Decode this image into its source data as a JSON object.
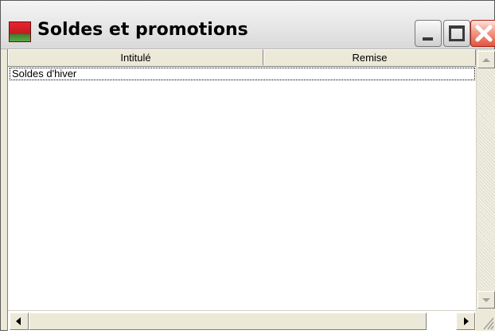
{
  "window": {
    "title": "Soldes et promotions",
    "icon": "app-flag-icon",
    "controls": [
      "minimize-icon",
      "maximize-icon",
      "close-icon"
    ]
  },
  "table": {
    "columns": [
      {
        "label": "Intitulé"
      },
      {
        "label": "Remise"
      }
    ],
    "rows": [
      {
        "intitule": "Soldes d'hiver",
        "remise": ""
      }
    ]
  },
  "colors": {
    "titlebar": "#e6e6e6",
    "close_button": "#e2553d",
    "icon_red": "#e8242f",
    "icon_green": "#5da843"
  }
}
